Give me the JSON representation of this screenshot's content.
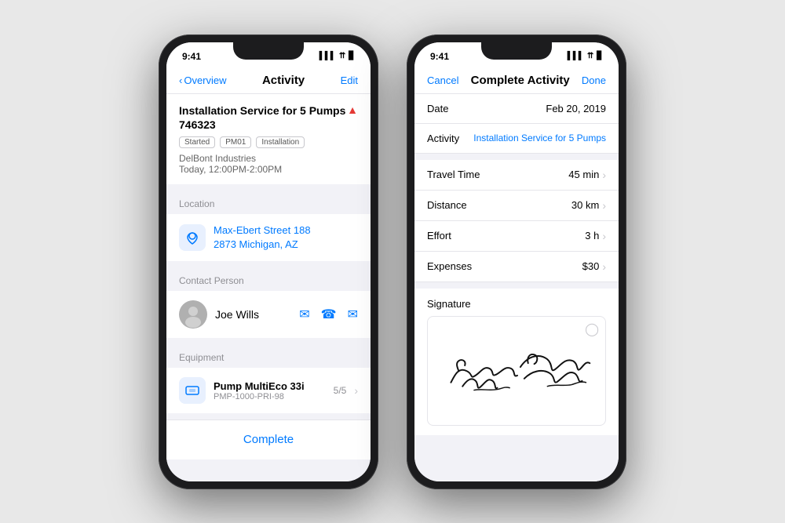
{
  "leftPhone": {
    "statusBar": {
      "time": "9:41",
      "icons": "▌▌▌ ▲ ▌"
    },
    "navBar": {
      "back": "Overview",
      "title": "Activity",
      "action": "Edit"
    },
    "activityCard": {
      "title": "Installation Service for 5 Pumps",
      "number": "746323",
      "alertIcon": "▲",
      "tags": [
        "Started",
        "PM01",
        "Installation"
      ],
      "company": "DelBont Industries",
      "time": "Today, 12:00PM-2:00PM"
    },
    "locationSection": {
      "label": "Location",
      "addressLine1": "Max-Ebert Street 188",
      "addressLine2": "2873 Michigan, AZ"
    },
    "contactSection": {
      "label": "Contact Person",
      "name": "Joe Wills"
    },
    "equipmentSection": {
      "label": "Equipment",
      "name": "Pump MultiEco 33i",
      "id": "PMP-1000-PRI-98",
      "count": "5/5"
    },
    "completeButton": "Complete"
  },
  "rightPhone": {
    "statusBar": {
      "time": "9:41",
      "icons": "▌▌▌ ▲ ▌"
    },
    "navBar": {
      "cancel": "Cancel",
      "title": "Complete Activity",
      "done": "Done"
    },
    "fields": [
      {
        "label": "Date",
        "value": "Feb 20, 2019",
        "hasChevron": false
      },
      {
        "label": "Activity",
        "value": "Installation Service for 5 Pumps",
        "hasChevron": false,
        "valueSmall": true
      }
    ],
    "detailFields": [
      {
        "label": "Travel Time",
        "value": "45 min",
        "hasChevron": true
      },
      {
        "label": "Distance",
        "value": "30 km",
        "hasChevron": true
      },
      {
        "label": "Effort",
        "value": "3 h",
        "hasChevron": true
      },
      {
        "label": "Expenses",
        "value": "$30",
        "hasChevron": true
      }
    ],
    "signatureSection": {
      "label": "Signature",
      "clearIcon": "⊗"
    }
  }
}
